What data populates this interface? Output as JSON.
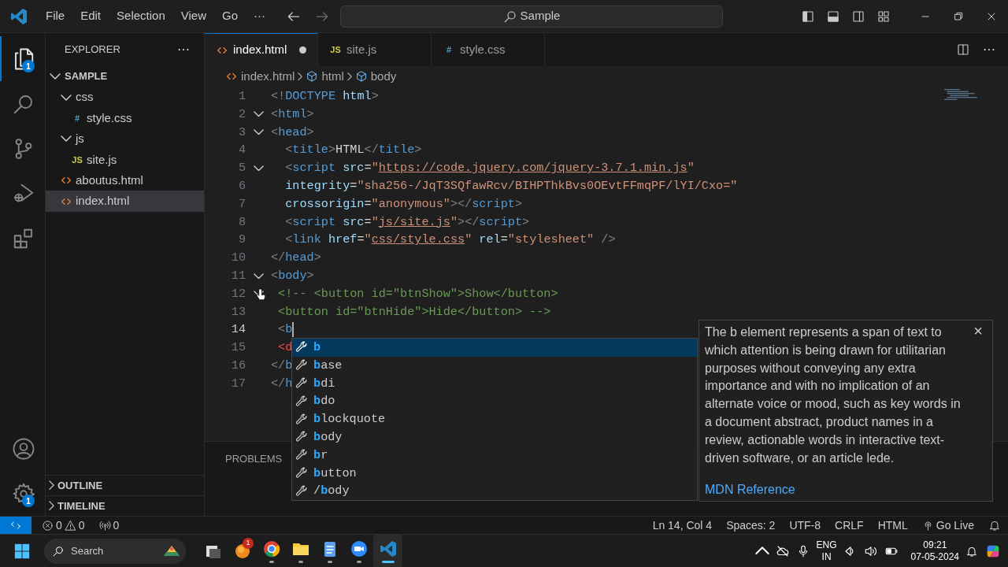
{
  "title_bar": {
    "menu": [
      "File",
      "Edit",
      "Selection",
      "View",
      "Go",
      "···"
    ],
    "search": "Sample"
  },
  "activity_bar": [
    {
      "kind": "explorer",
      "selected": true,
      "badge": "1"
    },
    {
      "kind": "search",
      "selected": false
    },
    {
      "kind": "source-control",
      "selected": false
    },
    {
      "kind": "run-debug",
      "selected": false
    },
    {
      "kind": "extensions",
      "selected": false
    }
  ],
  "activity_bar_bottom": [
    {
      "kind": "account"
    },
    {
      "kind": "settings",
      "badge": "1"
    }
  ],
  "sidebar": {
    "title": "EXPLORER",
    "more": "···",
    "tree": [
      {
        "label": "SAMPLE",
        "kind": "folder",
        "expanded": true,
        "selected": false,
        "children": [
          {
            "label": "css",
            "kind": "folder",
            "expanded": true,
            "selected": false,
            "children": [
              {
                "label": "style.css",
                "kind": "css",
                "icon": "#",
                "selected": false
              }
            ]
          },
          {
            "label": "js",
            "kind": "folder",
            "expanded": true,
            "selected": false,
            "children": [
              {
                "label": "site.js",
                "kind": "js",
                "icon": "JS",
                "selected": false
              }
            ]
          },
          {
            "label": "aboutus.html",
            "kind": "html",
            "selected": false
          },
          {
            "label": "index.html",
            "kind": "html",
            "selected": true
          }
        ]
      }
    ],
    "sections": [
      {
        "label": "OUTLINE",
        "expanded": false
      },
      {
        "label": "TIMELINE",
        "expanded": false
      }
    ]
  },
  "tabs": [
    {
      "label": "index.html",
      "kind": "html",
      "selected": true,
      "dirty": true
    },
    {
      "label": "site.js",
      "kind": "js",
      "icon": "JS",
      "selected": false,
      "dirty": false
    },
    {
      "label": "style.css",
      "kind": "css",
      "icon": "#",
      "selected": false,
      "dirty": false
    }
  ],
  "editor_actions": {
    "more": "···"
  },
  "breadcrumbs": [
    {
      "label": "index.html",
      "kind": "html"
    },
    {
      "label": "html",
      "kind": "symbol"
    },
    {
      "label": "body",
      "kind": "symbol"
    }
  ],
  "code": [
    {
      "number": "1",
      "current": false,
      "foldable": false,
      "tokens": [
        {
          "kind": "p",
          "text": "<!"
        },
        {
          "kind": "tag",
          "text": "DOCTYPE"
        },
        {
          "kind": "attr",
          "text": " html"
        },
        {
          "kind": "p",
          "text": ">"
        }
      ]
    },
    {
      "number": "2",
      "current": false,
      "foldable": true,
      "tokens": [
        {
          "kind": "p",
          "text": "<"
        },
        {
          "kind": "tag",
          "text": "html"
        },
        {
          "kind": "p",
          "text": ">"
        }
      ]
    },
    {
      "number": "3",
      "current": false,
      "foldable": true,
      "tokens": [
        {
          "kind": "p",
          "text": "<"
        },
        {
          "kind": "tag",
          "text": "head"
        },
        {
          "kind": "p",
          "text": ">"
        }
      ]
    },
    {
      "number": "4",
      "current": false,
      "foldable": false,
      "tokens": [
        {
          "kind": "p",
          "text": "  <"
        },
        {
          "kind": "tag",
          "text": "title"
        },
        {
          "kind": "p",
          "text": ">"
        },
        {
          "kind": "text",
          "text": "HTML"
        },
        {
          "kind": "p",
          "text": "</"
        },
        {
          "kind": "tag",
          "text": "title"
        },
        {
          "kind": "p",
          "text": ">"
        }
      ]
    },
    {
      "number": "5",
      "current": false,
      "foldable": true,
      "tokens": [
        {
          "kind": "p",
          "text": "  <"
        },
        {
          "kind": "tag",
          "text": "script"
        },
        {
          "kind": "attr",
          "text": " src"
        },
        {
          "kind": "text",
          "text": "="
        },
        {
          "kind": "str",
          "text": "\""
        },
        {
          "kind": "link",
          "text": "https://code.jquery.com/jquery-3.7.1.min.js"
        },
        {
          "kind": "str",
          "text": "\""
        }
      ]
    },
    {
      "number": "6",
      "current": false,
      "foldable": false,
      "tokens": [
        {
          "kind": "attr",
          "text": "  integrity"
        },
        {
          "kind": "text",
          "text": "="
        },
        {
          "kind": "str",
          "text": "\"sha256-/JqT3SQfawRcv/BIHPThkBvs0OEvtFFmqPF/lYI/Cxo=\""
        }
      ]
    },
    {
      "number": "7",
      "current": false,
      "foldable": false,
      "tokens": [
        {
          "kind": "attr",
          "text": "  crossorigin"
        },
        {
          "kind": "text",
          "text": "="
        },
        {
          "kind": "str",
          "text": "\"anonymous\""
        },
        {
          "kind": "p",
          "text": "></"
        },
        {
          "kind": "tag",
          "text": "script"
        },
        {
          "kind": "p",
          "text": ">"
        }
      ]
    },
    {
      "number": "8",
      "current": false,
      "foldable": false,
      "tokens": [
        {
          "kind": "p",
          "text": "  <"
        },
        {
          "kind": "tag",
          "text": "script"
        },
        {
          "kind": "attr",
          "text": " src"
        },
        {
          "kind": "text",
          "text": "="
        },
        {
          "kind": "str",
          "text": "\""
        },
        {
          "kind": "link",
          "text": "js/site.js"
        },
        {
          "kind": "str",
          "text": "\""
        },
        {
          "kind": "p",
          "text": "></"
        },
        {
          "kind": "tag",
          "text": "script"
        },
        {
          "kind": "p",
          "text": ">"
        }
      ]
    },
    {
      "number": "9",
      "current": false,
      "foldable": false,
      "tokens": [
        {
          "kind": "p",
          "text": "  <"
        },
        {
          "kind": "tag",
          "text": "link"
        },
        {
          "kind": "attr",
          "text": " href"
        },
        {
          "kind": "text",
          "text": "="
        },
        {
          "kind": "str",
          "text": "\""
        },
        {
          "kind": "link",
          "text": "css/style.css"
        },
        {
          "kind": "str",
          "text": "\""
        },
        {
          "kind": "attr",
          "text": " rel"
        },
        {
          "kind": "text",
          "text": "="
        },
        {
          "kind": "str",
          "text": "\"stylesheet\""
        },
        {
          "kind": "p",
          "text": " />"
        }
      ]
    },
    {
      "number": "10",
      "current": false,
      "foldable": false,
      "tokens": [
        {
          "kind": "p",
          "text": "</"
        },
        {
          "kind": "tag",
          "text": "head"
        },
        {
          "kind": "p",
          "text": ">"
        }
      ]
    },
    {
      "number": "11",
      "current": false,
      "foldable": true,
      "tokens": [
        {
          "kind": "p",
          "text": "<"
        },
        {
          "kind": "tag",
          "text": "body"
        },
        {
          "kind": "p",
          "text": ">"
        }
      ]
    },
    {
      "number": "12",
      "current": false,
      "foldable": true,
      "tokens": [
        {
          "kind": "comment",
          "text": " <!-- <button id=\"btnShow\">Show</button>"
        }
      ]
    },
    {
      "number": "13",
      "current": false,
      "foldable": false,
      "tokens": [
        {
          "kind": "comment",
          "text": " <button id=\"btnHide\">Hide</button> -->"
        }
      ]
    },
    {
      "number": "14",
      "current": true,
      "foldable": false,
      "tokens": [
        {
          "kind": "p",
          "text": " <"
        },
        {
          "kind": "tag",
          "text": "b"
        }
      ]
    },
    {
      "number": "15",
      "current": false,
      "foldable": false,
      "tokens": [
        {
          "kind": "err",
          "text": " <d"
        }
      ]
    },
    {
      "number": "16",
      "current": false,
      "foldable": false,
      "tokens": [
        {
          "kind": "p",
          "text": "</"
        },
        {
          "kind": "tag",
          "text": "b"
        }
      ]
    },
    {
      "number": "17",
      "current": false,
      "foldable": false,
      "tokens": [
        {
          "kind": "p",
          "text": "</"
        },
        {
          "kind": "tag",
          "text": "h"
        }
      ]
    }
  ],
  "suggestions": [
    {
      "match": "b",
      "selected": true
    },
    {
      "match": "b",
      "after": "ase",
      "selected": false
    },
    {
      "match": "b",
      "after": "di",
      "selected": false
    },
    {
      "match": "b",
      "after": "do",
      "selected": false
    },
    {
      "match": "b",
      "after": "lockquote",
      "selected": false
    },
    {
      "match": "b",
      "after": "ody",
      "selected": false
    },
    {
      "match": "b",
      "after": "r",
      "selected": false
    },
    {
      "match": "b",
      "after": "utton",
      "selected": false
    },
    {
      "before": "/",
      "match": "b",
      "after": "ody",
      "selected": false
    }
  ],
  "details": {
    "text": "The b element represents a span of text to which attention is being drawn for utilitarian purposes without conveying any extra importance and with no implication of an alternate voice or mood, such as key words in a document abstract, product names in a review, actionable words in interactive text-driven software, or an article lede.",
    "link": "MDN Reference",
    "close": "×"
  },
  "panel": {
    "tabs": [
      "PROBLEMS"
    ]
  },
  "status_bar": {
    "errors": "0",
    "warnings": "0",
    "ports": "0",
    "items": [
      "Ln 14, Col 4",
      "Spaces: 2",
      "UTF-8",
      "CRLF",
      "HTML"
    ],
    "go_live": "Go Live"
  },
  "taskbar": {
    "search": "Search",
    "apps": [
      {
        "kind": "task-view",
        "running": false,
        "selected": false
      },
      {
        "kind": "orange-app",
        "badge": "1",
        "running": false,
        "selected": false
      },
      {
        "kind": "browser",
        "running": true,
        "selected": false
      },
      {
        "kind": "folder",
        "running": true,
        "selected": false
      },
      {
        "kind": "notepad",
        "running": true,
        "selected": false
      },
      {
        "kind": "video",
        "running": true,
        "selected": false
      },
      {
        "kind": "code",
        "running": true,
        "selected": true
      }
    ],
    "language": "ENG",
    "region": "IN",
    "time": "09:21",
    "date": "07-05-2024"
  }
}
